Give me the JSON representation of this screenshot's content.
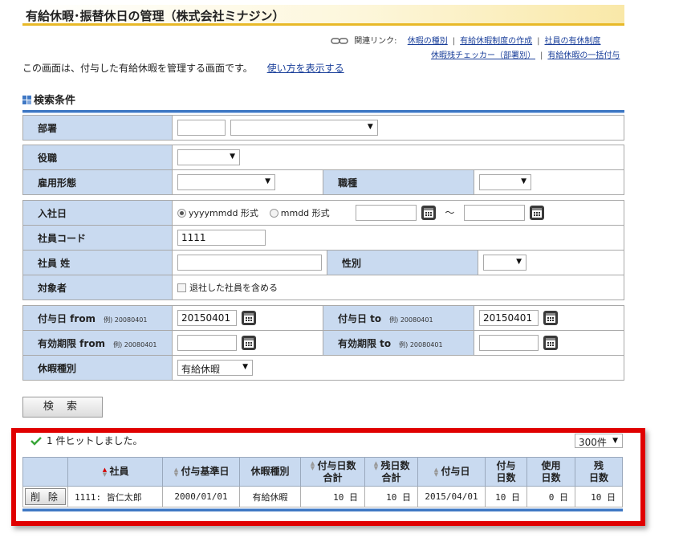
{
  "title": "有給休暇･振替休日の管理（株式会社ミナジン）",
  "related": {
    "label": "関連リンク:",
    "links_row1": [
      "休暇の種別",
      "有給休暇制度の作成",
      "社員の有休制度"
    ],
    "links_row2": [
      "休暇残チェッカー（部署別）",
      "有給休暇の一括付与"
    ]
  },
  "description": "この画面は、付与した有給休暇を管理する画面です。",
  "help_link": "使い方を表示する",
  "search_section": "検索条件",
  "form": {
    "dept": "部署",
    "position": "役職",
    "employment_type": "雇用形態",
    "job_type": "職種",
    "hire_date": "入社日",
    "radio_yyyymmdd": "yyyymmdd 形式",
    "radio_mmdd": "mmdd 形式",
    "tilde": "〜",
    "employee_code": "社員コード",
    "employee_code_value": "1111",
    "last_name": "社員 姓",
    "gender": "性別",
    "target": "対象者",
    "include_retired": "退社した社員を含める",
    "grant_from": "付与日 from",
    "grant_to": "付与日 to",
    "example": "例) 20080401",
    "grant_from_value": "20150401",
    "grant_to_value": "20150401",
    "expire_from": "有効期限 from",
    "expire_to": "有効期限 to",
    "leave_type": "休暇種別",
    "leave_type_value": "有給休暇"
  },
  "search_button": "検 索",
  "results": {
    "hit_message": "1 件ヒットしました。",
    "per_page": "300件",
    "headers": {
      "employee": "社員",
      "base_date": "付与基準日",
      "leave_type": "休暇種別",
      "grant_days_total_1": "付与日数",
      "grant_days_total_2": "合計",
      "remaining_total_1": "残日数",
      "remaining_total_2": "合計",
      "grant_date": "付与日",
      "grant_days_1": "付与",
      "grant_days_2": "日数",
      "used_days_1": "使用",
      "used_days_2": "日数",
      "remain_days_1": "残",
      "remain_days_2": "日数"
    },
    "rows": [
      {
        "delete": "削 除",
        "employee": "1111: 皆仁太郎",
        "base_date": "2000/01/01",
        "leave_type": "有給休暇",
        "grant_total": "10 日",
        "remain_total": "10 日",
        "grant_date": "2015/04/01",
        "grant_days": "10 日",
        "used_days": "0 日",
        "remain_days": "10 日"
      }
    ]
  },
  "colors": {
    "accent": "#3f78c4",
    "label_bg": "#c9daf0",
    "highlight": "#e00000",
    "title_bar": "#e8b928"
  },
  "icons": [
    "link-chain-icon",
    "grid-section-icon",
    "calendar-icon",
    "check-icon",
    "sort-arrows-icon",
    "dropdown-arrow-icon"
  ]
}
